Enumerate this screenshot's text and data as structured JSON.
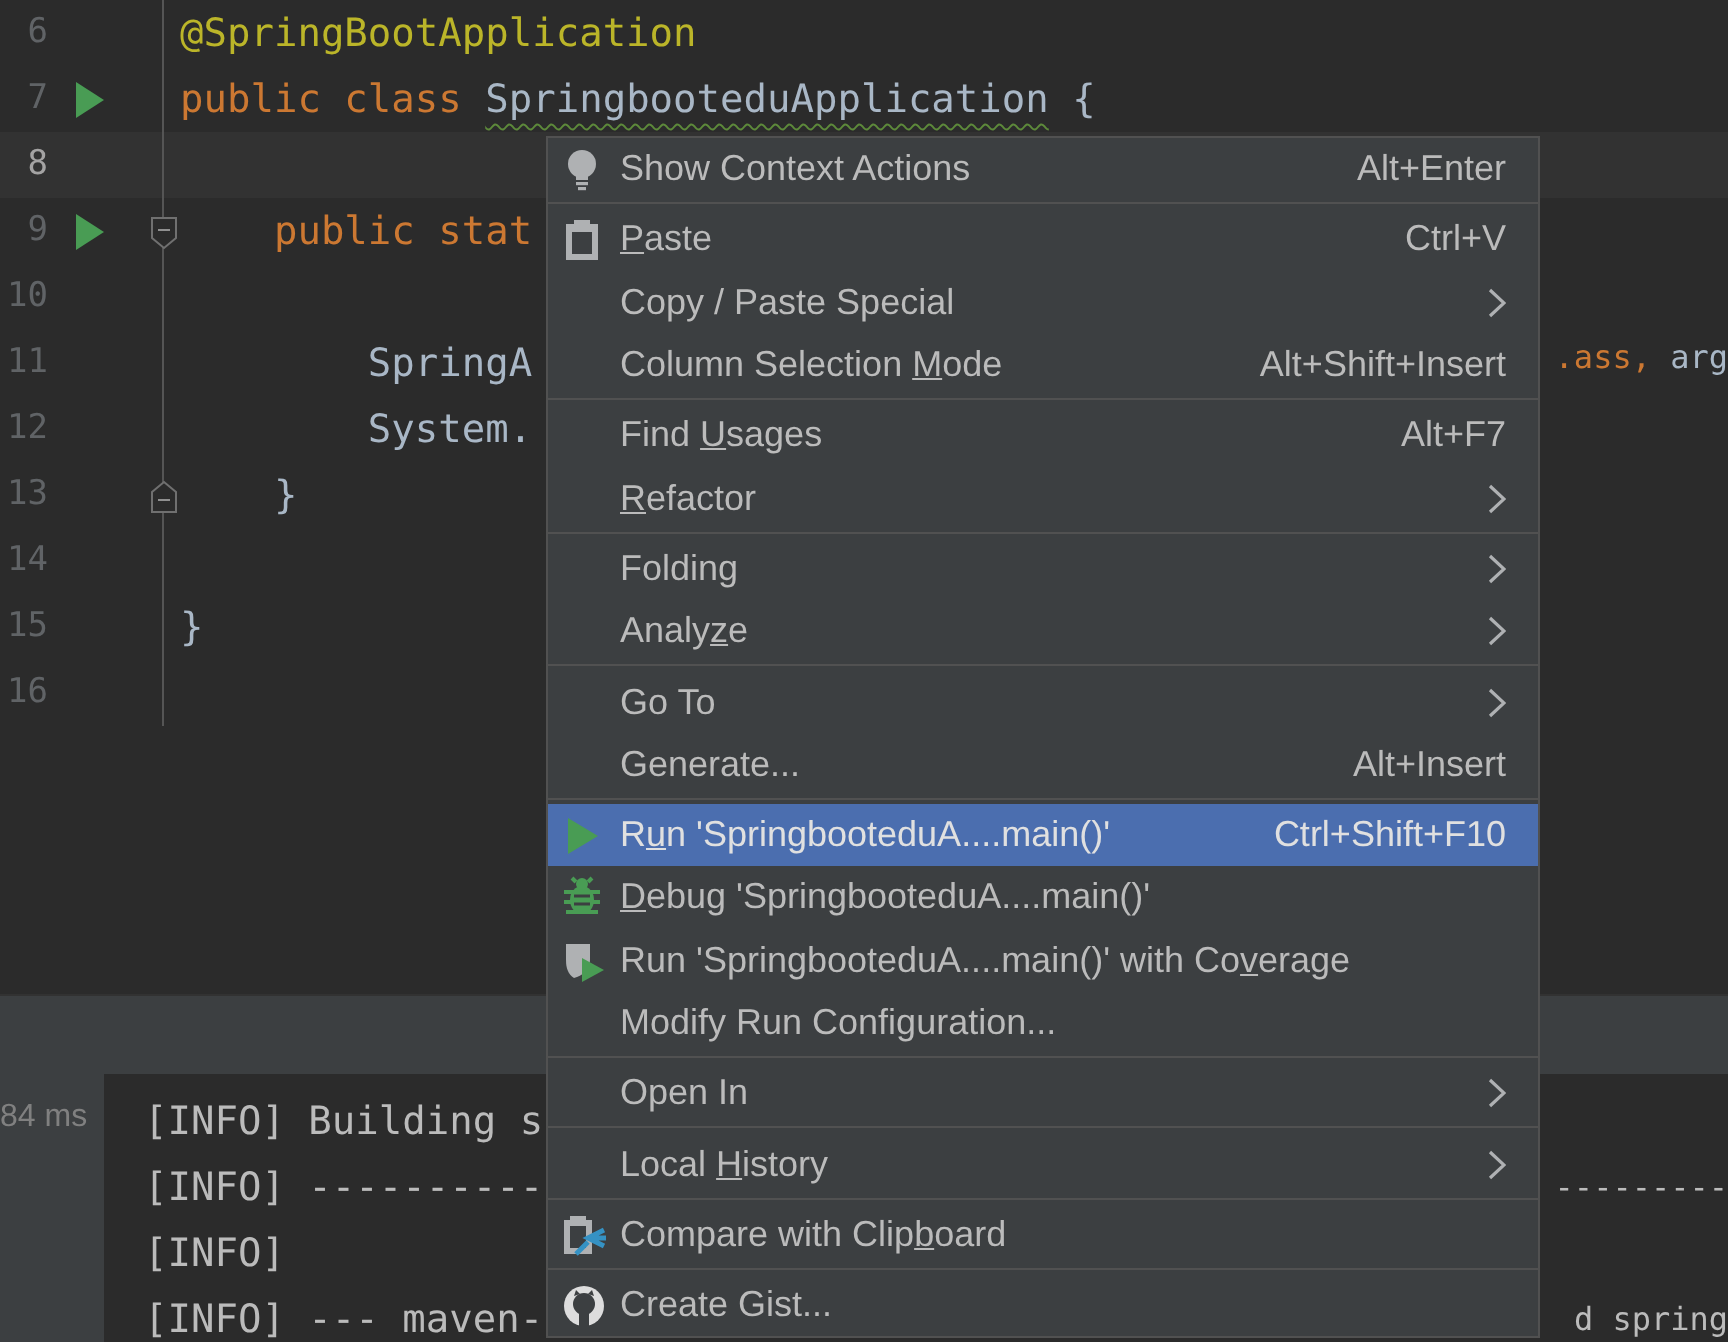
{
  "editor": {
    "lines": [
      {
        "number": "6",
        "current": false,
        "run": false,
        "kind": "plain",
        "tokens": [
          {
            "text": "@SpringBootApplication",
            "kind": "annotation"
          }
        ]
      },
      {
        "number": "7",
        "current": false,
        "run": true,
        "kind": "plain",
        "tokens": [
          {
            "text": "public class ",
            "kind": "keyword"
          },
          {
            "text": "SpringbooteduApplication",
            "kind": "warn"
          },
          {
            "text": " {",
            "kind": "plain"
          }
        ]
      },
      {
        "number": "8",
        "current": true,
        "run": false,
        "kind": "plain"
      },
      {
        "number": "9",
        "current": false,
        "run": true,
        "kind": "fold_start",
        "tokens": [
          {
            "text": "    public stat",
            "kind": "keyword"
          }
        ]
      },
      {
        "number": "10",
        "current": false,
        "run": false,
        "kind": "plain"
      },
      {
        "number": "11",
        "current": false,
        "run": false,
        "kind": "plain",
        "tokens": [
          {
            "text": "        SpringA",
            "kind": "plain"
          }
        ],
        "right_tokens": [
          {
            "text": ".ass,",
            "kind": "keyword"
          },
          {
            "text": " arg",
            "kind": "plain"
          }
        ]
      },
      {
        "number": "12",
        "current": false,
        "run": false,
        "kind": "plain",
        "tokens": [
          {
            "text": "        System.",
            "kind": "plain"
          }
        ]
      },
      {
        "number": "13",
        "current": false,
        "run": false,
        "kind": "fold_end",
        "tokens": [
          {
            "text": "    }",
            "kind": "plain"
          }
        ]
      },
      {
        "number": "14",
        "current": false,
        "run": false,
        "kind": "plain"
      },
      {
        "number": "15",
        "current": false,
        "run": false,
        "kind": "plain",
        "tokens": [
          {
            "text": "}",
            "kind": "plain"
          }
        ]
      },
      {
        "number": "16",
        "current": false,
        "run": false,
        "kind": "plain"
      }
    ]
  },
  "console": {
    "duration": "84 ms",
    "lines": [
      {
        "text": "[INFO] Building s"
      },
      {
        "text": "[INFO] ----------",
        "right": "---------"
      },
      {
        "text": "[INFO]"
      },
      {
        "text": "[INFO] --- maven-",
        "right": "d spring"
      }
    ]
  },
  "context_menu": {
    "groups": [
      [
        {
          "label": [
            {
              "text": "Show Context Actions",
              "underlined": false
            }
          ],
          "shortcut": "Alt+Enter",
          "kind": "bulb",
          "submenu": false,
          "selected": false
        }
      ],
      [
        {
          "label": [
            {
              "text": "P",
              "underlined": true
            },
            {
              "text": "aste",
              "underlined": false
            }
          ],
          "shortcut": "Ctrl+V",
          "kind": "clipboard",
          "submenu": false,
          "selected": false
        },
        {
          "label": [
            {
              "text": "Copy / Paste Special",
              "underlined": false
            }
          ],
          "kind": "plain",
          "submenu": true,
          "selected": false
        },
        {
          "label": [
            {
              "text": "Column Selection ",
              "underlined": false
            },
            {
              "text": "M",
              "underlined": true
            },
            {
              "text": "ode",
              "underlined": false
            }
          ],
          "shortcut": "Alt+Shift+Insert",
          "kind": "plain",
          "submenu": false,
          "selected": false
        }
      ],
      [
        {
          "label": [
            {
              "text": "Find ",
              "underlined": false
            },
            {
              "text": "U",
              "underlined": true
            },
            {
              "text": "sages",
              "underlined": false
            }
          ],
          "shortcut": "Alt+F7",
          "kind": "plain",
          "submenu": false,
          "selected": false
        },
        {
          "label": [
            {
              "text": "R",
              "underlined": true
            },
            {
              "text": "efactor",
              "underlined": false
            }
          ],
          "kind": "plain",
          "submenu": true,
          "selected": false
        }
      ],
      [
        {
          "label": [
            {
              "text": "Folding",
              "underlined": false
            }
          ],
          "kind": "plain",
          "submenu": true,
          "selected": false
        },
        {
          "label": [
            {
              "text": "Analy",
              "underlined": false
            },
            {
              "text": "z",
              "underlined": true
            },
            {
              "text": "e",
              "underlined": false
            }
          ],
          "kind": "plain",
          "submenu": true,
          "selected": false
        }
      ],
      [
        {
          "label": [
            {
              "text": "Go To",
              "underlined": false
            }
          ],
          "kind": "plain",
          "submenu": true,
          "selected": false
        },
        {
          "label": [
            {
              "text": "Generate...",
              "underlined": false
            }
          ],
          "shortcut": "Alt+Insert",
          "kind": "plain",
          "submenu": false,
          "selected": false
        }
      ],
      [
        {
          "label": [
            {
              "text": "R",
              "underlined": false
            },
            {
              "text": "u",
              "underlined": true
            },
            {
              "text": "n 'SpringbooteduA....main()'",
              "underlined": false
            }
          ],
          "shortcut": "Ctrl+Shift+F10",
          "kind": "run",
          "submenu": false,
          "selected": true
        },
        {
          "label": [
            {
              "text": "D",
              "underlined": true
            },
            {
              "text": "ebug 'SpringbooteduA....main()'",
              "underlined": false
            }
          ],
          "kind": "debug",
          "submenu": false,
          "selected": false
        },
        {
          "label": [
            {
              "text": "Run 'SpringbooteduA....main()' with Co",
              "underlined": false
            },
            {
              "text": "v",
              "underlined": true
            },
            {
              "text": "erage",
              "underlined": false
            }
          ],
          "kind": "coverage",
          "submenu": false,
          "selected": false
        },
        {
          "label": [
            {
              "text": "Modify Run Configuration...",
              "underlined": false
            }
          ],
          "kind": "plain",
          "submenu": false,
          "selected": false
        }
      ],
      [
        {
          "label": [
            {
              "text": "Open In",
              "underlined": false
            }
          ],
          "kind": "plain",
          "submenu": true,
          "selected": false
        }
      ],
      [
        {
          "label": [
            {
              "text": "Local ",
              "underlined": false
            },
            {
              "text": "H",
              "underlined": true
            },
            {
              "text": "istory",
              "underlined": false
            }
          ],
          "kind": "plain",
          "submenu": true,
          "selected": false
        }
      ],
      [
        {
          "label": [
            {
              "text": "Compare with Clip",
              "underlined": false
            },
            {
              "text": "b",
              "underlined": true
            },
            {
              "text": "oard",
              "underlined": false
            }
          ],
          "kind": "compare",
          "submenu": false,
          "selected": false
        }
      ],
      [
        {
          "label": [
            {
              "text": "Create Gist...",
              "underlined": false
            }
          ],
          "kind": "github",
          "submenu": false,
          "selected": false
        }
      ]
    ]
  }
}
